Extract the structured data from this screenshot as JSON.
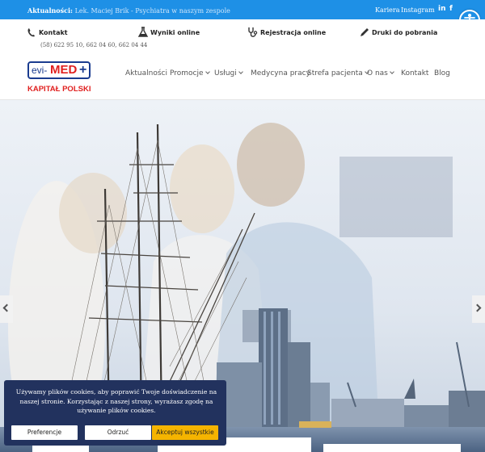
{
  "topbar": {
    "news_label": "Aktualności:",
    "news_text": "Lek. Maciej Brik - Psychiatra w naszym zespole",
    "links": [
      "Kariera",
      "Instagram"
    ],
    "social": [
      "in",
      "f"
    ]
  },
  "contact": {
    "phone_label": "Kontakt",
    "phone_numbers": "(58) 622 95 10, 662 04 60, 662 04 44",
    "results_label": "Wyniki online",
    "registration_label": "Rejestracja online",
    "forms_label": "Druki do pobrania"
  },
  "logo": {
    "prefix": "evi-",
    "brand": "MED",
    "plus": "+",
    "subtitle": "KAPITAŁ POLSKI"
  },
  "nav": {
    "items": [
      {
        "label": "Aktualności",
        "dropdown": false
      },
      {
        "label": "Promocje",
        "dropdown": true
      },
      {
        "label": "Usługi",
        "dropdown": true
      },
      {
        "label": "Medycyna pracy",
        "dropdown": false
      },
      {
        "label": "Strefa pacjenta",
        "dropdown": true
      },
      {
        "label": "O nas",
        "dropdown": true
      },
      {
        "label": "Kontakt",
        "dropdown": false
      },
      {
        "label": "Blog",
        "dropdown": false
      }
    ]
  },
  "cookie": {
    "text": "Używamy plików cookies, aby poprawić Twoje doświadczenie na naszej stronie. Korzystając z naszej strony, wyrażasz zgodę na używanie plików cookies.",
    "preferences": "Preferencje",
    "reject": "Odrzuć",
    "accept": "Akceptuj wszystkie"
  },
  "colors": {
    "topbar": "#1e90e6",
    "cookie_bg": "#22325e",
    "accept_btn": "#f5b400",
    "logo_red": "#e0201f",
    "logo_blue": "#1a3c8f"
  },
  "icons": [
    "phone-icon",
    "flask-icon",
    "stethoscope-icon",
    "pen-icon",
    "accessibility-icon"
  ]
}
